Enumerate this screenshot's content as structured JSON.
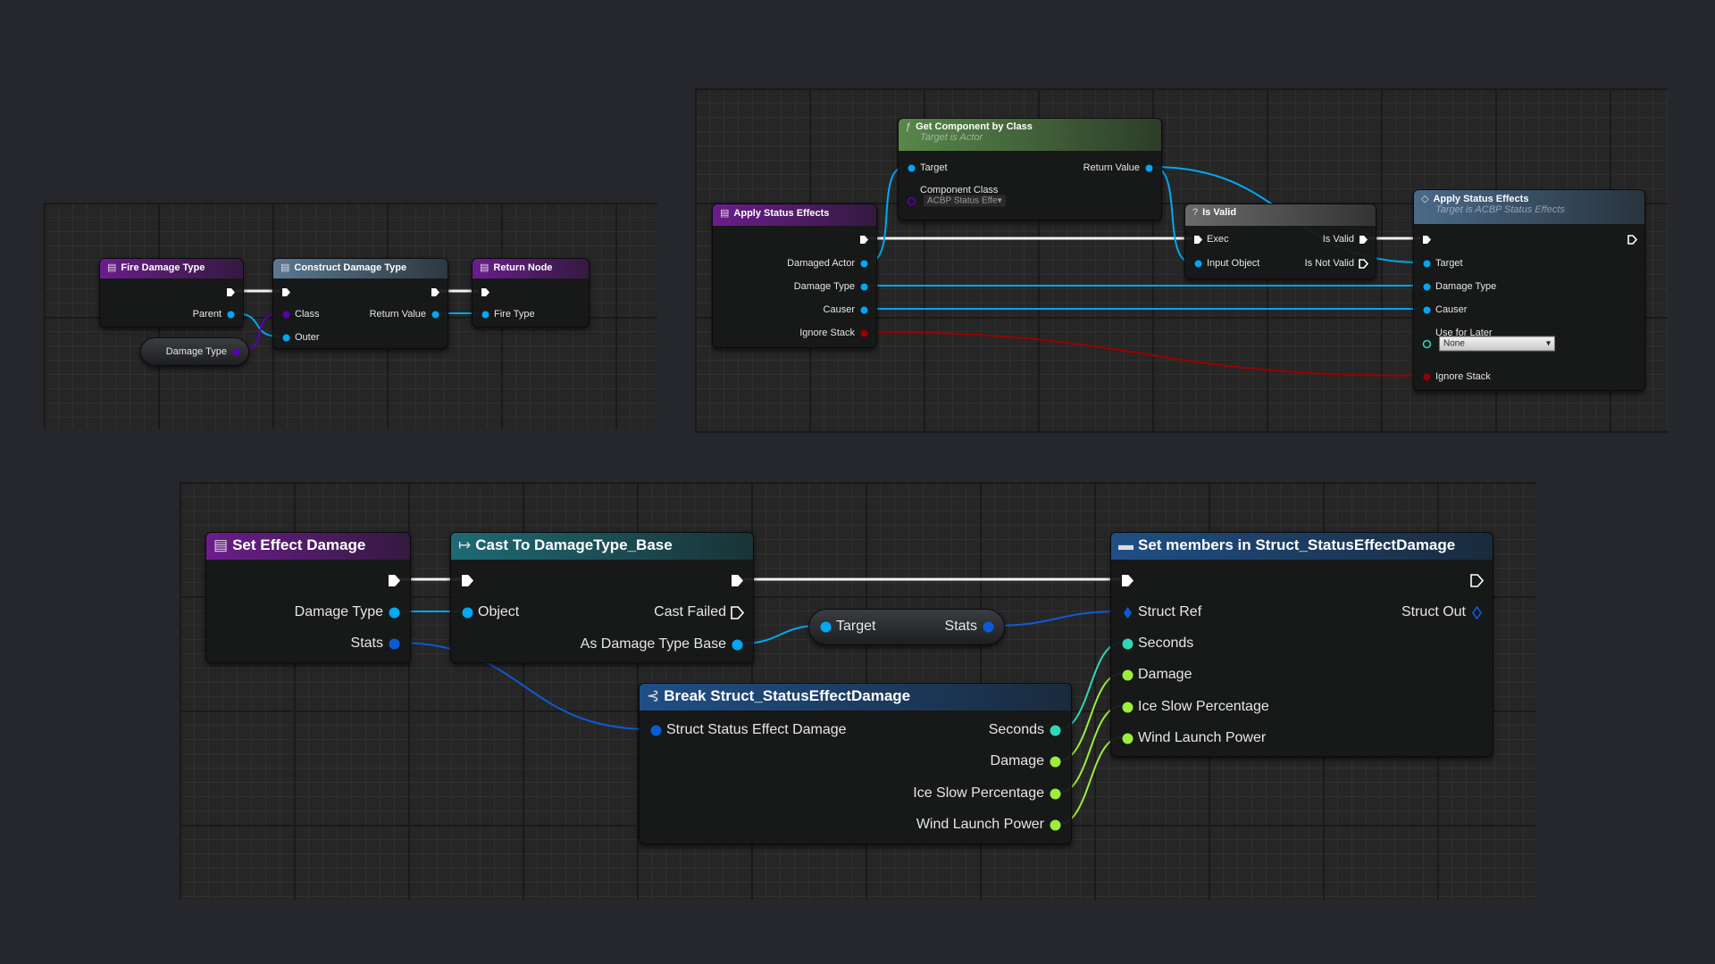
{
  "colors": {
    "exec": "#ffffff",
    "object": "#00a8f4",
    "class": "#5a00b5",
    "bool": "#9a0000",
    "struct": "#0b5bd6",
    "float_seconds": "#2fd8b5",
    "float": "#9cee3a",
    "background": "#25272d"
  },
  "nodes": [
    {
      "id": "fire",
      "title": "Fire Damage Type",
      "header": "#6b1d8c",
      "icon": "function-entry-icon",
      "left": [],
      "right": [
        {
          "label": "",
          "type": "exec"
        },
        {
          "label": "Parent",
          "type": "object"
        }
      ]
    },
    {
      "id": "construct",
      "title": "Construct Damage Type",
      "header": "#5a7890",
      "icon": "function-entry-icon",
      "left": [
        {
          "label": "",
          "type": "exec"
        },
        {
          "label": "Class",
          "type": "class"
        },
        {
          "label": "Outer",
          "type": "object"
        }
      ],
      "right": [
        {
          "label": "",
          "type": "exec"
        },
        {
          "label": "Return Value",
          "type": "object"
        }
      ]
    },
    {
      "id": "ret",
      "title": "Return Node",
      "header": "#6b1d8c",
      "icon": "function-entry-icon",
      "left": [
        {
          "label": "",
          "type": "exec"
        },
        {
          "label": "Fire Type",
          "type": "object"
        }
      ],
      "right": []
    },
    {
      "id": "dmgvar",
      "pill": true,
      "left": [],
      "right": [
        {
          "label": "Damage Type",
          "type": "class"
        }
      ]
    },
    {
      "id": "getcomp",
      "title": "Get Component by Class",
      "subtitle": "Target is Actor",
      "header": "#58874a",
      "icon": "function-icon",
      "left": [
        {
          "label": "Target",
          "type": "object"
        },
        {
          "label": "Component Class",
          "type": "class",
          "hollow": true,
          "default": "ACBP Status Effe",
          "dd": "dark"
        }
      ],
      "right": [
        {
          "label": "Return Value",
          "type": "object"
        }
      ]
    },
    {
      "id": "applyL",
      "title": "Apply Status Effects",
      "header": "#6b1d8c",
      "icon": "function-entry-icon",
      "left": [],
      "right": [
        {
          "label": "",
          "type": "exec"
        },
        {
          "label": "Damaged Actor",
          "type": "object"
        },
        {
          "label": "Damage Type",
          "type": "object"
        },
        {
          "label": "Causer",
          "type": "object"
        },
        {
          "label": "Ignore Stack",
          "type": "bool"
        }
      ]
    },
    {
      "id": "isvalid",
      "title": "Is Valid",
      "header": "#6a6a6a",
      "icon": "question-icon",
      "left": [
        {
          "label": "Exec",
          "type": "exec"
        },
        {
          "label": "Input Object",
          "type": "object"
        }
      ],
      "right": [
        {
          "label": "Is Valid",
          "type": "exec"
        },
        {
          "label": "Is Not Valid",
          "type": "exec",
          "hollow": true
        }
      ]
    },
    {
      "id": "applyR",
      "title": "Apply Status Effects",
      "subtitle": "Target is ACBP Status Effects",
      "header": "#4a6a88",
      "icon": "event-diamond-icon",
      "left": [
        {
          "label": "",
          "type": "exec"
        },
        {
          "label": "Target",
          "type": "object"
        },
        {
          "label": "Damage Type",
          "type": "object"
        },
        {
          "label": "Causer",
          "type": "object"
        },
        {
          "label": "Use for Later",
          "type": "float_seconds",
          "hollow": true,
          "default": "None",
          "dd": "light"
        },
        {
          "label": "Ignore Stack",
          "type": "bool"
        }
      ],
      "right": [
        {
          "label": "",
          "type": "exec",
          "hollow": true
        }
      ]
    },
    {
      "id": "seteff",
      "title": "Set Effect Damage",
      "header": "#6b1d8c",
      "icon": "function-entry-icon",
      "left": [],
      "right": [
        {
          "label": "",
          "type": "exec"
        },
        {
          "label": "Damage Type",
          "type": "object"
        },
        {
          "label": "Stats",
          "type": "struct"
        }
      ]
    },
    {
      "id": "cast",
      "title": "Cast To DamageType_Base",
      "header": "#1e6a74",
      "icon": "cast-icon",
      "left": [
        {
          "label": "",
          "type": "exec"
        },
        {
          "label": "Object",
          "type": "object"
        }
      ],
      "right": [
        {
          "label": "",
          "type": "exec"
        },
        {
          "label": "Cast Failed",
          "type": "exec",
          "hollow": true
        },
        {
          "label": "As Damage Type Base",
          "type": "object"
        }
      ]
    },
    {
      "id": "stats",
      "pill": true,
      "left": [
        {
          "label": "Target",
          "type": "object"
        }
      ],
      "right": [
        {
          "label": "Stats",
          "type": "struct"
        }
      ]
    },
    {
      "id": "brk",
      "title": "Break Struct_StatusEffectDamage",
      "header": "#1f4f86",
      "icon": "break-struct-icon",
      "left": [
        {
          "label": "Struct Status Effect Damage",
          "type": "struct"
        }
      ],
      "right": [
        {
          "label": "Seconds",
          "type": "float_seconds"
        },
        {
          "label": "Damage",
          "type": "float"
        },
        {
          "label": "Ice Slow Percentage",
          "type": "float"
        },
        {
          "label": "Wind Launch Power",
          "type": "float"
        }
      ]
    },
    {
      "id": "setm",
      "title": "Set members in Struct_StatusEffectDamage",
      "header": "#1f4f86",
      "icon": "set-members-icon",
      "left": [
        {
          "label": "",
          "type": "exec"
        },
        {
          "label": "Struct Ref",
          "type": "struct",
          "diamond": true
        },
        {
          "label": "Seconds",
          "type": "float_seconds"
        },
        {
          "label": "Damage",
          "type": "float"
        },
        {
          "label": "Ice Slow Percentage",
          "type": "float"
        },
        {
          "label": "Wind Launch Power",
          "type": "float"
        }
      ],
      "right": [
        {
          "label": "",
          "type": "exec",
          "hollow": true
        },
        {
          "label": "Struct Out",
          "type": "struct",
          "diamond": true,
          "hollow": true
        }
      ]
    }
  ],
  "wires": [
    {
      "from": "fire.r.0",
      "to": "construct.l.0",
      "type": "exec"
    },
    {
      "from": "construct.r.0",
      "to": "ret.l.0",
      "type": "exec"
    },
    {
      "from": "construct.r.1",
      "to": "ret.l.1",
      "type": "object"
    },
    {
      "from": "fire.r.1",
      "to": "construct.l.2",
      "type": "object"
    },
    {
      "from": "dmgvar.r.0",
      "to": "construct.l.1",
      "type": "class"
    },
    {
      "from": "applyL.r.0",
      "to": "isvalid.l.0",
      "type": "exec"
    },
    {
      "from": "isvalid.r.0",
      "to": "applyR.l.0",
      "type": "exec"
    },
    {
      "from": "applyL.r.1",
      "to": "getcomp.l.0",
      "type": "object"
    },
    {
      "from": "getcomp.r.0",
      "to": "isvalid.l.1",
      "type": "object"
    },
    {
      "from": "getcomp.r.0",
      "to": "applyR.l.1",
      "type": "object"
    },
    {
      "from": "applyL.r.2",
      "to": "applyR.l.2",
      "type": "object"
    },
    {
      "from": "applyL.r.3",
      "to": "applyR.l.3",
      "type": "object"
    },
    {
      "from": "applyL.r.4",
      "to": "applyR.l.5",
      "type": "bool"
    },
    {
      "from": "seteff.r.0",
      "to": "cast.l.0",
      "type": "exec"
    },
    {
      "from": "cast.r.0",
      "to": "setm.l.0",
      "type": "exec"
    },
    {
      "from": "seteff.r.1",
      "to": "cast.l.1",
      "type": "object"
    },
    {
      "from": "cast.r.2",
      "to": "stats.l.0",
      "type": "object"
    },
    {
      "from": "stats.r.0",
      "to": "setm.l.1",
      "type": "struct"
    },
    {
      "from": "seteff.r.2",
      "to": "brk.l.0",
      "type": "struct"
    },
    {
      "from": "brk.r.0",
      "to": "setm.l.2",
      "type": "float_seconds"
    },
    {
      "from": "brk.r.1",
      "to": "setm.l.3",
      "type": "float"
    },
    {
      "from": "brk.r.2",
      "to": "setm.l.4",
      "type": "float"
    },
    {
      "from": "brk.r.3",
      "to": "setm.l.5",
      "type": "float"
    }
  ]
}
